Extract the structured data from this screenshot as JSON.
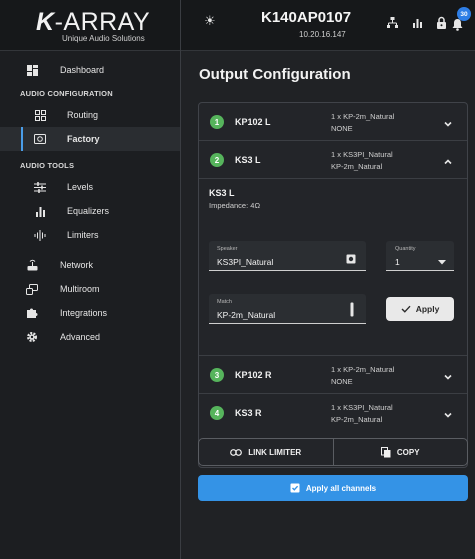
{
  "brand": {
    "logo_k": "K",
    "logo_rest": "-ARRAY",
    "tagline": "Unique Audio Solutions"
  },
  "header": {
    "device_name": "K140AP0107",
    "ip": "10.20.16.147",
    "notifications": "30"
  },
  "sidebar": {
    "dashboard": "Dashboard",
    "audio_config_title": "AUDIO CONFIGURATION",
    "routing": "Routing",
    "factory": "Factory",
    "audio_tools_title": "AUDIO TOOLS",
    "levels": "Levels",
    "equalizers": "Equalizers",
    "limiters": "Limiters",
    "network": "Network",
    "multiroom": "Multiroom",
    "integrations": "Integrations",
    "advanced": "Advanced"
  },
  "main": {
    "title": "Output Configuration",
    "outputs": [
      {
        "num": "1",
        "name": "KP102 L",
        "line1": "1 x KP-2m_Natural",
        "line2": "NONE"
      },
      {
        "num": "2",
        "name": "KS3 L",
        "line1": "1 x KS3PI_Natural",
        "line2": "KP-2m_Natural"
      },
      {
        "num": "3",
        "name": "KP102 R",
        "line1": "1 x KP-2m_Natural",
        "line2": "NONE"
      },
      {
        "num": "4",
        "name": "KS3 R",
        "line1": "1 x KS3PI_Natural",
        "line2": "KP-2m_Natural"
      }
    ],
    "expanded": {
      "title": "KS3 L",
      "impedance": "Impedance: 4Ω",
      "speaker_label": "Speaker",
      "speaker_value": "KS3PI_Natural",
      "quantity_label": "Quantity",
      "quantity_value": "1",
      "match_label": "Match",
      "match_value": "KP-2m_Natural",
      "apply_label": "Apply"
    },
    "link_limiter": "LINK LIMITER",
    "copy": "COPY",
    "apply_all": "Apply all channels"
  },
  "colors": {
    "accent": "#3493e6",
    "active_bar": "#4a9de8",
    "badge": "#2e7ee6",
    "channel_green": "#56b45c"
  }
}
